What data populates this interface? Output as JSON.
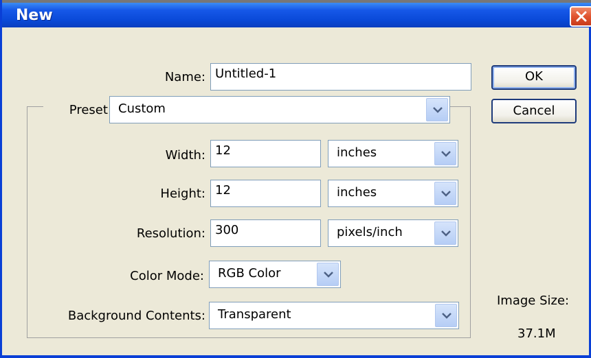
{
  "window": {
    "title": "New"
  },
  "name_field": {
    "label": "Name:",
    "value": "Untitled-1"
  },
  "preset": {
    "label": "Preset:",
    "value": "Custom"
  },
  "width": {
    "label": "Width:",
    "value": "12",
    "unit": "inches"
  },
  "height": {
    "label": "Height:",
    "value": "12",
    "unit": "inches"
  },
  "resolution": {
    "label": "Resolution:",
    "value": "300",
    "unit": "pixels/inch"
  },
  "color_mode": {
    "label": "Color Mode:",
    "value": "RGB Color"
  },
  "background_contents": {
    "label": "Background Contents:",
    "value": "Transparent"
  },
  "buttons": {
    "ok": "OK",
    "cancel": "Cancel"
  },
  "image_size": {
    "label": "Image Size:",
    "value": "37.1M"
  },
  "colors": {
    "titlebar": "#0a49d8",
    "dialog_bg": "#ece9d8",
    "close_button": "#e05430",
    "dropdown_arrow_bg": "#c5d8f8"
  },
  "icons": {
    "close": "close-icon",
    "dropdown": "chevron-down-icon"
  }
}
